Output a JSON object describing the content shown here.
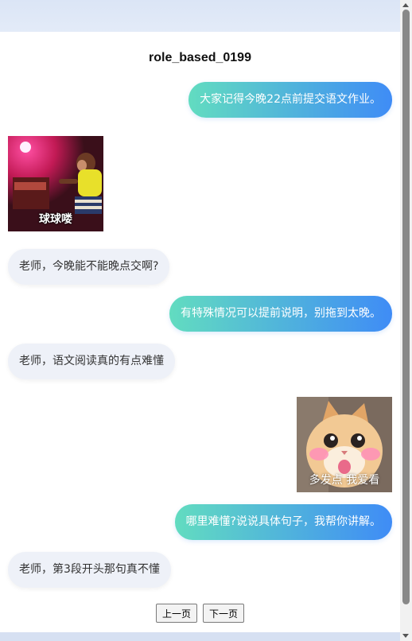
{
  "title": "role_based_0199",
  "messages": [
    {
      "side": "out",
      "text": "大家记得今晚22点前提交语文作业。"
    },
    {
      "side": "in",
      "sticker_caption": "球球喽"
    },
    {
      "side": "in",
      "text": "老师，今晚能不能晚点交啊?"
    },
    {
      "side": "out",
      "text": "有特殊情况可以提前说明，别拖到太晚。"
    },
    {
      "side": "in",
      "text": "老师，语文阅读真的有点难懂"
    },
    {
      "side": "out",
      "sticker_caption": "多发点 我爱看"
    },
    {
      "side": "out",
      "text": "哪里难懂?说说具体句子，我帮你讲解。"
    },
    {
      "side": "in",
      "text": "老师，第3段开头那句真不懂"
    }
  ],
  "pager": {
    "prev": "上一页",
    "next": "下一页"
  },
  "colors": {
    "bubble_out_start": "#62dcc0",
    "bubble_out_end": "#3f8cf6",
    "bubble_in": "#eef1f8"
  }
}
